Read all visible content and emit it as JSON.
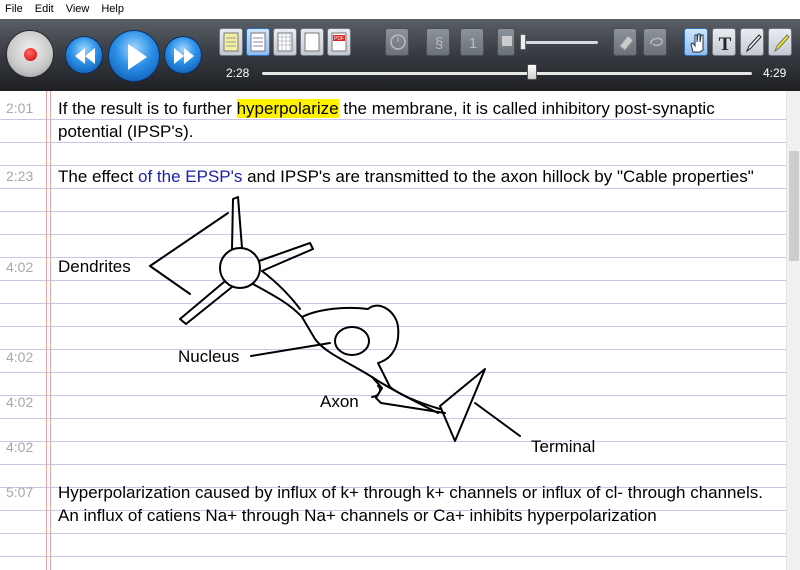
{
  "menu": {
    "items": [
      "File",
      "Edit",
      "View",
      "Help"
    ]
  },
  "player": {
    "current_time": "2:28",
    "total_time": "4:29",
    "progress_fraction": 0.55
  },
  "notes": [
    {
      "timestamp": "2:01",
      "text_before": "If the result is to further ",
      "highlight": "hyperpolarize",
      "text_after": " the membrane, it is called inhibitory post-synaptic potential (IPSP's)."
    },
    {
      "timestamp": "2:23",
      "text_before": "The effect ",
      "blue": "of the EPSP's",
      "text_after": " and IPSP's are transmitted to the axon hillock by \"Cable properties\""
    },
    {
      "timestamp": "4:02",
      "label": "Dendrites"
    },
    {
      "timestamp": "4:02",
      "label": "Nucleus"
    },
    {
      "timestamp": "4:02",
      "label": "Axon"
    },
    {
      "timestamp": "4:02",
      "label": "Terminal"
    },
    {
      "timestamp": "5:07",
      "text": "Hyperpolarization caused by influx of k+ through k+ channels or influx of cl- through channels. An influx of catiens Na+ through Na+ channels or Ca+ inhibits hyperpolarization"
    }
  ],
  "colors": {
    "highlight": "#fff200",
    "blue_text": "#1a23a8",
    "line_color": "#cdc3e8",
    "margin": "#e8a4a4"
  }
}
